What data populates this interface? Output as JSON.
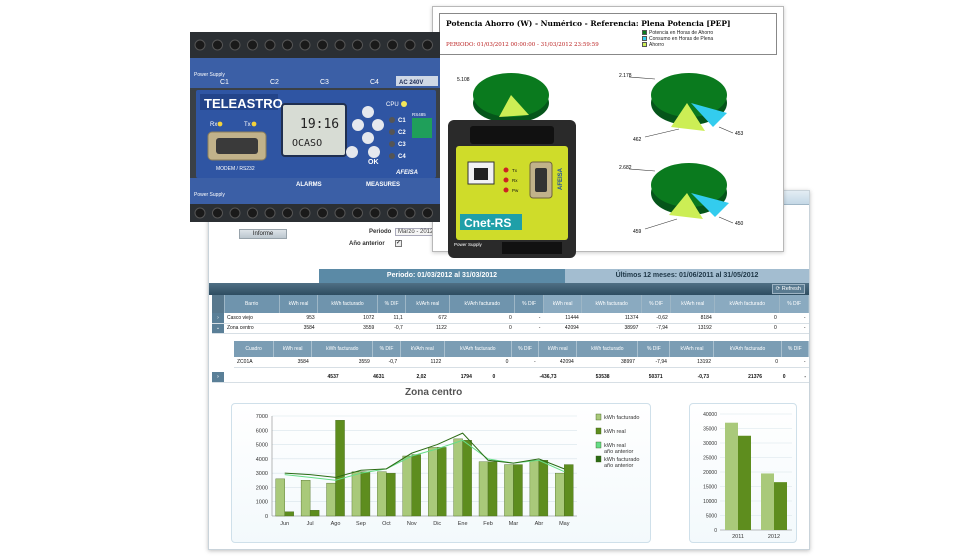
{
  "form": {
    "periodo_label": "Periodo",
    "periodo_value": "Marzo - 2012",
    "anio_anterior_label": "Año anterior",
    "informe_tab": "Informe"
  },
  "periods": {
    "current": "Periodo: 01/03/2012 al 31/03/2012",
    "last12": "Últimos 12 meses: 01/06/2011 al 31/05/2012"
  },
  "toolbar": {
    "refresh": "Refresh"
  },
  "grid": {
    "headers": [
      "Barrio",
      "kWh real",
      "kWh facturado",
      "% DIF",
      "kVArh real",
      "kVArh facturado",
      "% DIF",
      "kWh real",
      "kWh facturado",
      "% DIF",
      "kVArh real",
      "kVArh facturado",
      "% DIF"
    ],
    "rows": [
      {
        "expander": "›",
        "name": "Casco viejo",
        "cells": [
          "953",
          "1072",
          "11,1",
          "672",
          "0",
          "-",
          "11444",
          "11374",
          "-0,62",
          "8184",
          "0",
          "-"
        ]
      },
      {
        "expander": "⌄",
        "name": "Zona centro",
        "cells": [
          "3584",
          "3559",
          "-0,7",
          "1122",
          "0",
          "-",
          "42094",
          "38997",
          "-7,94",
          "13192",
          "0",
          "-"
        ]
      }
    ],
    "sub_headers": [
      "Cuadro",
      "kWh real",
      "kWh facturado",
      "% DIF",
      "kVArh real",
      "kVArh facturado",
      "% DIF",
      "kWh real",
      "kWh facturado",
      "% DIF",
      "kVArh real",
      "kVArh facturado",
      "% DIF"
    ],
    "sub_rows": [
      {
        "name": "ZC01A",
        "cells": [
          "3584",
          "3559",
          "-0,7",
          "1122",
          "0",
          "-",
          "42094",
          "38997",
          "-7,94",
          "13192",
          "0",
          "-"
        ]
      }
    ],
    "totals": {
      "expander": "›",
      "cells": [
        "4537",
        "4631",
        "2,02",
        "1794",
        "0",
        "-436,73",
        "53538",
        "50371",
        "-0,73",
        "21376",
        "0",
        "-"
      ]
    }
  },
  "chart_title": "Zona centro",
  "chart_data": [
    {
      "type": "bar",
      "title": "Zona centro",
      "categories": [
        "Jun",
        "Jul",
        "Ago",
        "Sep",
        "Oct",
        "Nov",
        "Dic",
        "Ene",
        "Feb",
        "Mar",
        "Abr",
        "May"
      ],
      "ylim": [
        0,
        7000
      ],
      "yticks": [
        0,
        1000,
        2000,
        3000,
        4000,
        5000,
        6000,
        7000
      ],
      "series": [
        {
          "name": "kWh facturado",
          "kind": "bar",
          "color": "#a9c97a",
          "values": [
            2600,
            2500,
            2300,
            3100,
            3100,
            4200,
            4800,
            5400,
            3800,
            3600,
            3900,
            3000
          ]
        },
        {
          "name": "kWh real",
          "kind": "bar",
          "color": "#5e8d1e",
          "values": [
            300,
            400,
            6700,
            3100,
            3000,
            4300,
            4800,
            5300,
            3800,
            3600,
            3900,
            3600
          ]
        },
        {
          "name": "kWh real año anterior",
          "kind": "line",
          "color": "#66dd88",
          "values": [
            2900,
            2700,
            2500,
            3000,
            3300,
            4200,
            4700,
            5300,
            4000,
            3700,
            3900,
            3100
          ]
        },
        {
          "name": "kWh facturado año anterior",
          "kind": "line",
          "color": "#2b6b14",
          "values": [
            3000,
            2900,
            2700,
            3200,
            3300,
            4400,
            5000,
            5800,
            3900,
            3700,
            4000,
            3300
          ]
        }
      ]
    },
    {
      "type": "bar",
      "categories": [
        "2011",
        "2012"
      ],
      "ylim": [
        0,
        40000
      ],
      "yticks": [
        0,
        5000,
        10000,
        15000,
        20000,
        25000,
        30000,
        35000,
        40000
      ],
      "series": [
        {
          "name": "kWh facturado",
          "color": "#a9c97a",
          "values": [
            37000,
            19500
          ]
        },
        {
          "name": "kWh real",
          "color": "#5e8d1e",
          "values": [
            32500,
            16500
          ]
        }
      ]
    },
    {
      "type": "pie",
      "title": "Potencia Ahorro (W) - Numérico - Referencia: Plena Potencia [PEP]",
      "series": [
        {
          "name": "Potencia en Horas de Ahorro",
          "color": "#0a7a1e"
        },
        {
          "name": "Consumo en Horas de Plena",
          "color": "#33ccee"
        },
        {
          "name": "Ahorro",
          "color": "#ccee55"
        }
      ]
    }
  ],
  "report": {
    "title": "Potencia Ahorro (W) - Numérico - Referencia: Plena Potencia [PEP]",
    "period": "PERIODO: 01/03/2012 00:00:00 - 31/03/2012 23:59:59",
    "legend": [
      "Potencia en Horas de Ahorro",
      "Consumo en Horas de Plena",
      "Ahorro"
    ],
    "pie_labels": [
      "5.108",
      "2.178",
      "462",
      "453",
      "2.682",
      "459",
      "450"
    ]
  },
  "device_teleastro": {
    "brand": "TELEASTRO",
    "display_time": "19:16",
    "display_text": "OCASO",
    "power_supply": "Power Supply",
    "rx": "Rx",
    "tx": "Tx",
    "modem": "MODEM / RS232",
    "cpu": "CPU",
    "channels": [
      "C1",
      "C2",
      "C3",
      "C4"
    ],
    "ok": "OK",
    "rs485": "RS485",
    "alarms": "ALARMS",
    "measures": "MEASURES",
    "ac": "AC 240V",
    "logo": "AFEISA"
  },
  "device_cnet": {
    "label": "Cnet-RS",
    "logo": "AFEISA",
    "power_supply": "Power Supply",
    "leds": [
      "Tx",
      "Rx",
      "Pw"
    ]
  }
}
